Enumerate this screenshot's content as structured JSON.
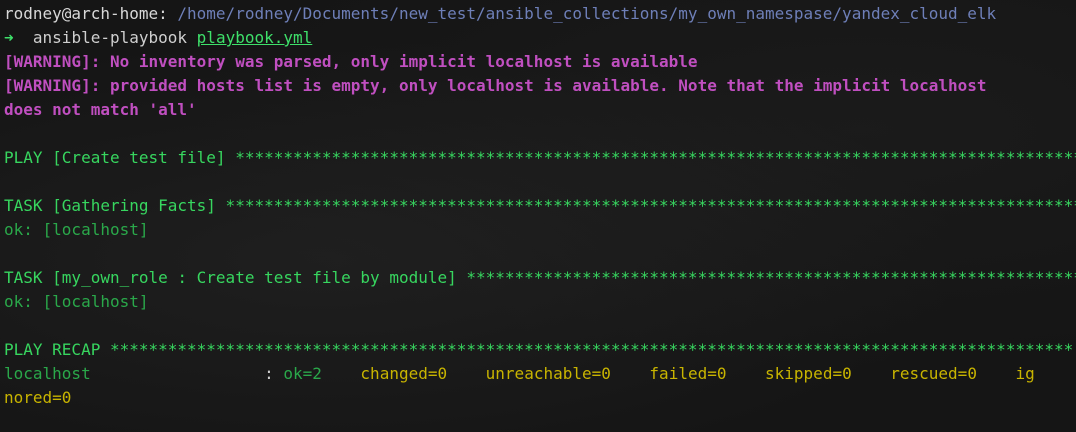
{
  "prompt": {
    "user_host": "rodney@arch-home",
    "separator": ": ",
    "path": "/home/rodney/Documents/new_test/ansible_collections/my_own_namespase/yandex_cloud_elk",
    "arrow": "➜",
    "command": "  ansible-playbook ",
    "argument": "playbook.yml"
  },
  "warnings": [
    "[WARNING]: No inventory was parsed, only implicit localhost is available",
    "[WARNING]: provided hosts list is empty, only localhost is available. Note that the implicit localhost",
    "does not match 'all'"
  ],
  "play_header": "PLAY [Create test file] ******************************************************************************************",
  "task1_header": "TASK [Gathering Facts] *******************************************************************************************",
  "task1_result": "ok: [localhost]",
  "task2_header": "TASK [my_own_role : Create test file by module] ******************************************************************",
  "task2_result": "ok: [localhost]",
  "recap_header": "PLAY RECAP ****************************************************************************************************",
  "recap": {
    "host": "localhost",
    "pad": "                  : ",
    "ok": "ok=2",
    "changed": "    changed=0",
    "unreachable": "    unreachable=0",
    "failed": "    failed=0",
    "skipped": "    skipped=0",
    "rescued": "    rescued=0",
    "ignored_start": "    ig",
    "ignored_end": "nored=0"
  }
}
